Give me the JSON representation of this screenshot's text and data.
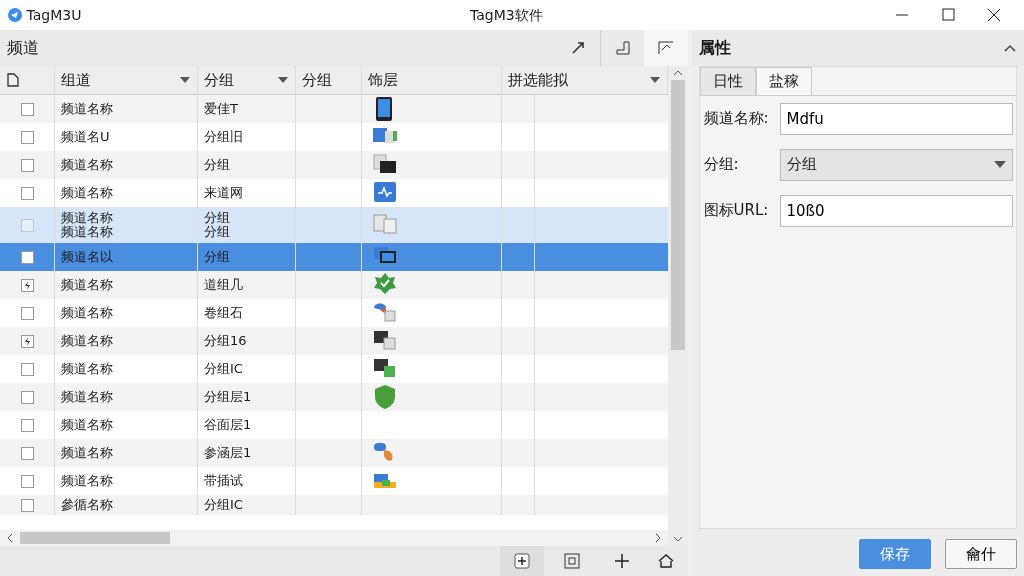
{
  "window": {
    "app_name": "TagM3U",
    "title": "TagM3软件"
  },
  "channels_panel": {
    "title": "频道",
    "columns": [
      {
        "label": "组道",
        "dropdown": true
      },
      {
        "label": "分组",
        "dropdown": true
      },
      {
        "label": "分组",
        "dropdown": false
      },
      {
        "label": "饰层",
        "dropdown": false
      },
      {
        "label": "拼选能拟",
        "dropdown": true
      }
    ],
    "rows": [
      {
        "name": "频道名称",
        "group": "爱佳T",
        "checked": false,
        "selected": false,
        "highlighted": false
      },
      {
        "name": "频道名U",
        "group": "分组旧",
        "checked": false,
        "selected": false,
        "highlighted": false
      },
      {
        "name": "频道名称",
        "group": "分组",
        "checked": false,
        "selected": false,
        "highlighted": false
      },
      {
        "name": "频道名称",
        "group": "来道网",
        "checked": false,
        "selected": false,
        "highlighted": false
      },
      {
        "name": "频道名称",
        "name_2": "频道名称",
        "group": "分组",
        "group_2": "分组",
        "checked": false,
        "selected": false,
        "highlighted": true
      },
      {
        "name": "频道名以",
        "group": "分组",
        "checked": false,
        "selected": true,
        "highlighted": false
      },
      {
        "name": "频道名称",
        "group": "道组几",
        "checked": true,
        "selected": false,
        "highlighted": false
      },
      {
        "name": "频道名称",
        "group": "卷组石",
        "checked": false,
        "selected": false,
        "highlighted": false
      },
      {
        "name": "频道名称",
        "group": "分组16",
        "checked": true,
        "selected": false,
        "highlighted": false
      },
      {
        "name": "频道名称",
        "group": "分组IC",
        "checked": false,
        "selected": false,
        "highlighted": false
      },
      {
        "name": "频道名称",
        "group": "分组层1",
        "checked": false,
        "selected": false,
        "highlighted": false
      },
      {
        "name": "频道名称",
        "group": "谷面层1",
        "checked": false,
        "selected": false,
        "highlighted": false
      },
      {
        "name": "频道名称",
        "group": "参涵层1",
        "checked": false,
        "selected": false,
        "highlighted": false
      },
      {
        "name": "频道名称",
        "group": "带插试",
        "checked": false,
        "selected": false,
        "highlighted": false
      },
      {
        "name": "參循名称",
        "group": "分组IC",
        "checked": false,
        "selected": false,
        "highlighted": false
      }
    ]
  },
  "properties_panel": {
    "title": "属性",
    "tabs": [
      {
        "label": "日性",
        "selected": false
      },
      {
        "label": "盐稼",
        "selected": true
      }
    ],
    "fields": [
      {
        "kind": "text",
        "label": "频道名称:",
        "value": "Mdfu"
      },
      {
        "kind": "select",
        "label": "分组:",
        "value": "分组"
      },
      {
        "kind": "text",
        "label": "图标URL:",
        "value": "10ß0"
      }
    ],
    "buttons": [
      {
        "label": "保存",
        "primary": true
      },
      {
        "label": "龠什",
        "primary": false
      }
    ]
  }
}
